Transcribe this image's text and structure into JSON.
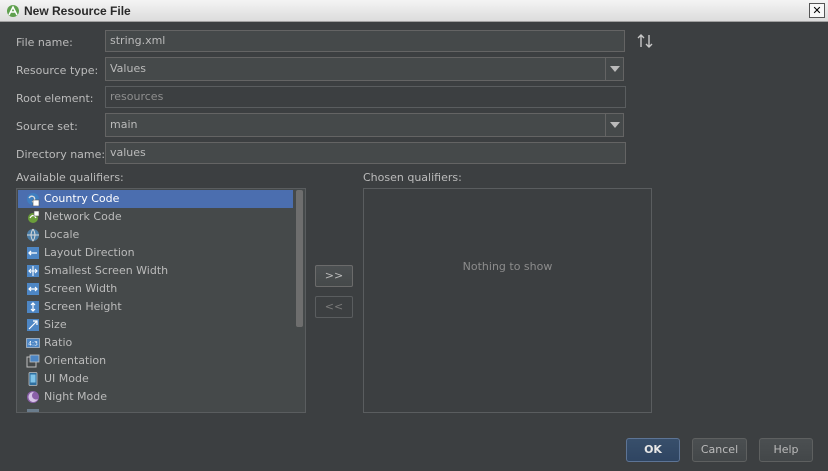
{
  "window": {
    "title": "New Resource File"
  },
  "form": {
    "file_name_label": "File name:",
    "file_name_value": "string.xml",
    "resource_type_label": "Resource type:",
    "resource_type_value": "Values",
    "root_element_label": "Root element:",
    "root_element_value": "resources",
    "source_set_label": "Source set:",
    "source_set_value": "main",
    "directory_name_label": "Directory name:",
    "directory_name_value": "values"
  },
  "qualifiers": {
    "available_label": "Available qualifiers:",
    "chosen_label": "Chosen qualifiers:",
    "chosen_empty": "Nothing to show",
    "add_label": ">>",
    "remove_label": "<<",
    "items": [
      {
        "label": "Country Code",
        "icon": "country-code-icon",
        "selected": true
      },
      {
        "label": "Network Code",
        "icon": "network-code-icon",
        "selected": false
      },
      {
        "label": "Locale",
        "icon": "locale-globe-icon",
        "selected": false
      },
      {
        "label": "Layout Direction",
        "icon": "layout-direction-icon",
        "selected": false
      },
      {
        "label": "Smallest Screen Width",
        "icon": "smallest-screen-width-icon",
        "selected": false
      },
      {
        "label": "Screen Width",
        "icon": "screen-width-icon",
        "selected": false
      },
      {
        "label": "Screen Height",
        "icon": "screen-height-icon",
        "selected": false
      },
      {
        "label": "Size",
        "icon": "size-icon",
        "selected": false
      },
      {
        "label": "Ratio",
        "icon": "ratio-icon",
        "selected": false
      },
      {
        "label": "Orientation",
        "icon": "orientation-icon",
        "selected": false
      },
      {
        "label": "UI Mode",
        "icon": "ui-mode-icon",
        "selected": false
      },
      {
        "label": "Night Mode",
        "icon": "night-mode-icon",
        "selected": false
      }
    ]
  },
  "buttons": {
    "ok": "OK",
    "cancel": "Cancel",
    "help": "Help"
  },
  "colors": {
    "selection": "#4b6eaf",
    "background": "#3c3f41",
    "field": "#45494a"
  }
}
